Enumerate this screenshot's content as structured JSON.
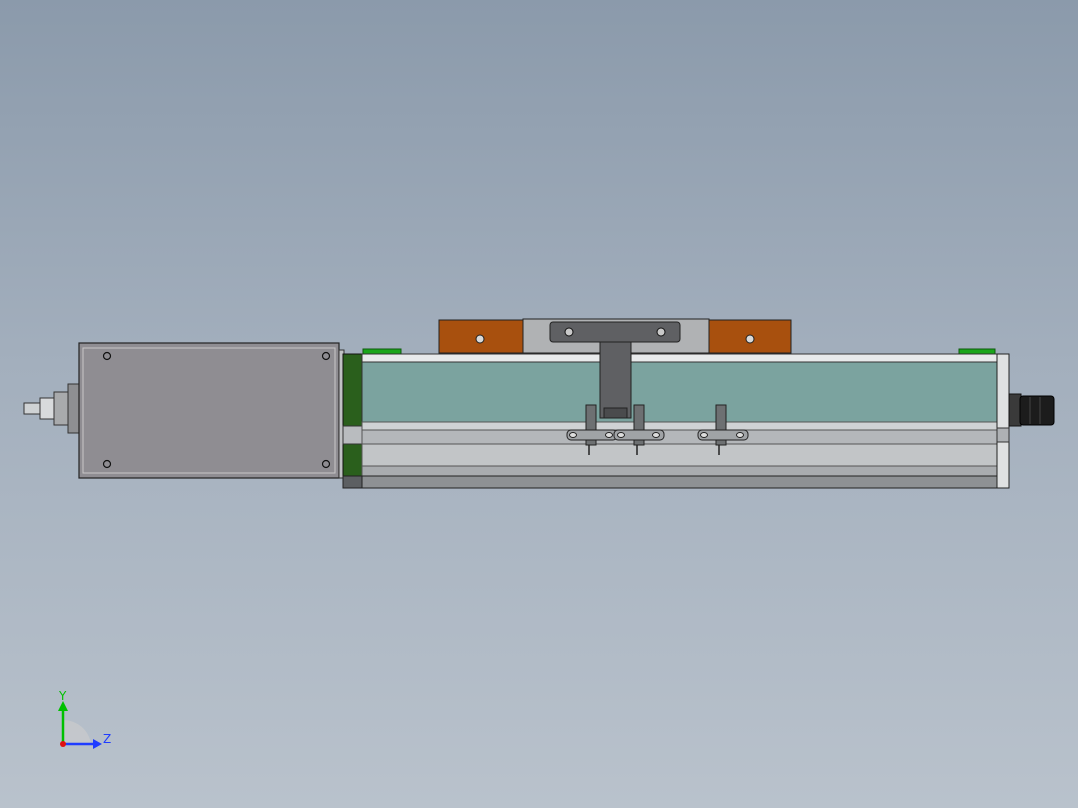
{
  "viewport": {
    "background_top": "#8b9aab",
    "background_bottom": "#b9c2cc"
  },
  "triad": {
    "y_label": "Y",
    "z_label": "Z",
    "y_color": "#00c000",
    "z_color": "#1f3cff",
    "x_color": "#e01010"
  },
  "colors": {
    "motor_body": "#8f8d92",
    "rail_cover": "#7ba39f",
    "bracket_orange": "#a8500e",
    "end_cap_green": "#2a5f1c",
    "marker_green": "#1aa51a",
    "profile_gray": "#b9bcbf",
    "carriage_gray": "#a8aaac",
    "connector_black": "#1c1c1c"
  }
}
